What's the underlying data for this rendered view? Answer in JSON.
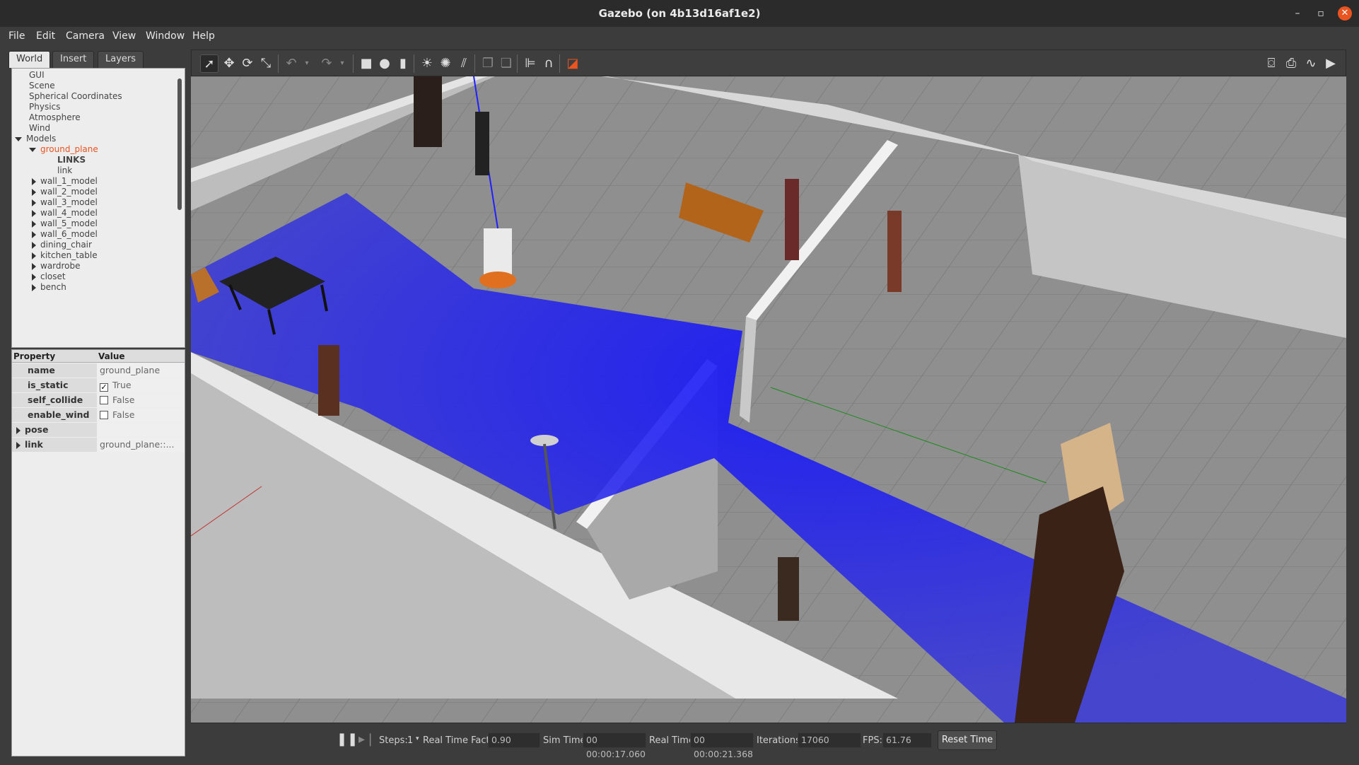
{
  "window": {
    "title": "Gazebo (on 4b13d16af1e2)",
    "minimize": "–",
    "restore": "▫",
    "close": "✕"
  },
  "menu": [
    {
      "label": "File"
    },
    {
      "label": "Edit"
    },
    {
      "label": "Camera"
    },
    {
      "label": "View"
    },
    {
      "label": "Window"
    },
    {
      "label": "Help"
    }
  ],
  "left_panel": {
    "tabs": [
      "World",
      "Insert",
      "Layers"
    ],
    "active_tab": "World",
    "tree": {
      "top_items": [
        "GUI",
        "Scene",
        "Spherical Coordinates",
        "Physics",
        "Atmosphere",
        "Wind"
      ],
      "models_label": "Models",
      "selected_model": "ground_plane",
      "links_label": "LINKS",
      "link_label": "link",
      "models": [
        "wall_1_model",
        "wall_2_model",
        "wall_3_model",
        "wall_4_model",
        "wall_5_model",
        "wall_6_model",
        "dining_chair",
        "kitchen_table",
        "wardrobe",
        "closet",
        "bench"
      ]
    },
    "properties": {
      "header_property": "Property",
      "header_value": "Value",
      "rows": [
        {
          "key": "name",
          "value": "ground_plane"
        },
        {
          "key": "is_static",
          "value": "True",
          "checked": true
        },
        {
          "key": "self_collide",
          "value": "False",
          "checked": false
        },
        {
          "key": "enable_wind",
          "value": "False",
          "checked": false
        },
        {
          "key": "pose",
          "value": ""
        },
        {
          "key": "link",
          "value": "ground_plane::..."
        }
      ]
    }
  },
  "toolbar": {
    "tools": [
      "select-mode",
      "translate-mode",
      "rotate-mode",
      "scale-mode",
      "undo",
      "redo",
      "box",
      "sphere",
      "cylinder",
      "point-light",
      "spot-light",
      "directional-light",
      "copy",
      "paste",
      "align",
      "snap",
      "view-angle"
    ],
    "right_tools": [
      "screenshot",
      "log",
      "plot",
      "record-video"
    ]
  },
  "bottom_bar": {
    "steps_label": "Steps:",
    "steps_value": "1",
    "rtf_label": "Real Time Factor:",
    "rtf_value": "0.90",
    "sim_time_label": "Sim Time:",
    "sim_time_value": "00 00:00:17.060",
    "real_time_label": "Real Time:",
    "real_time_value": "00 00:00:21.368",
    "iterations_label": "Iterations:",
    "iterations_value": "17060",
    "fps_label": "FPS:",
    "fps_value": "61.76",
    "reset_label": "Reset Time"
  },
  "colors": {
    "accent": "#e95420",
    "laser": "#2b2bd9",
    "floor": "#8a8a8a",
    "wall": "#e2e2e2"
  }
}
